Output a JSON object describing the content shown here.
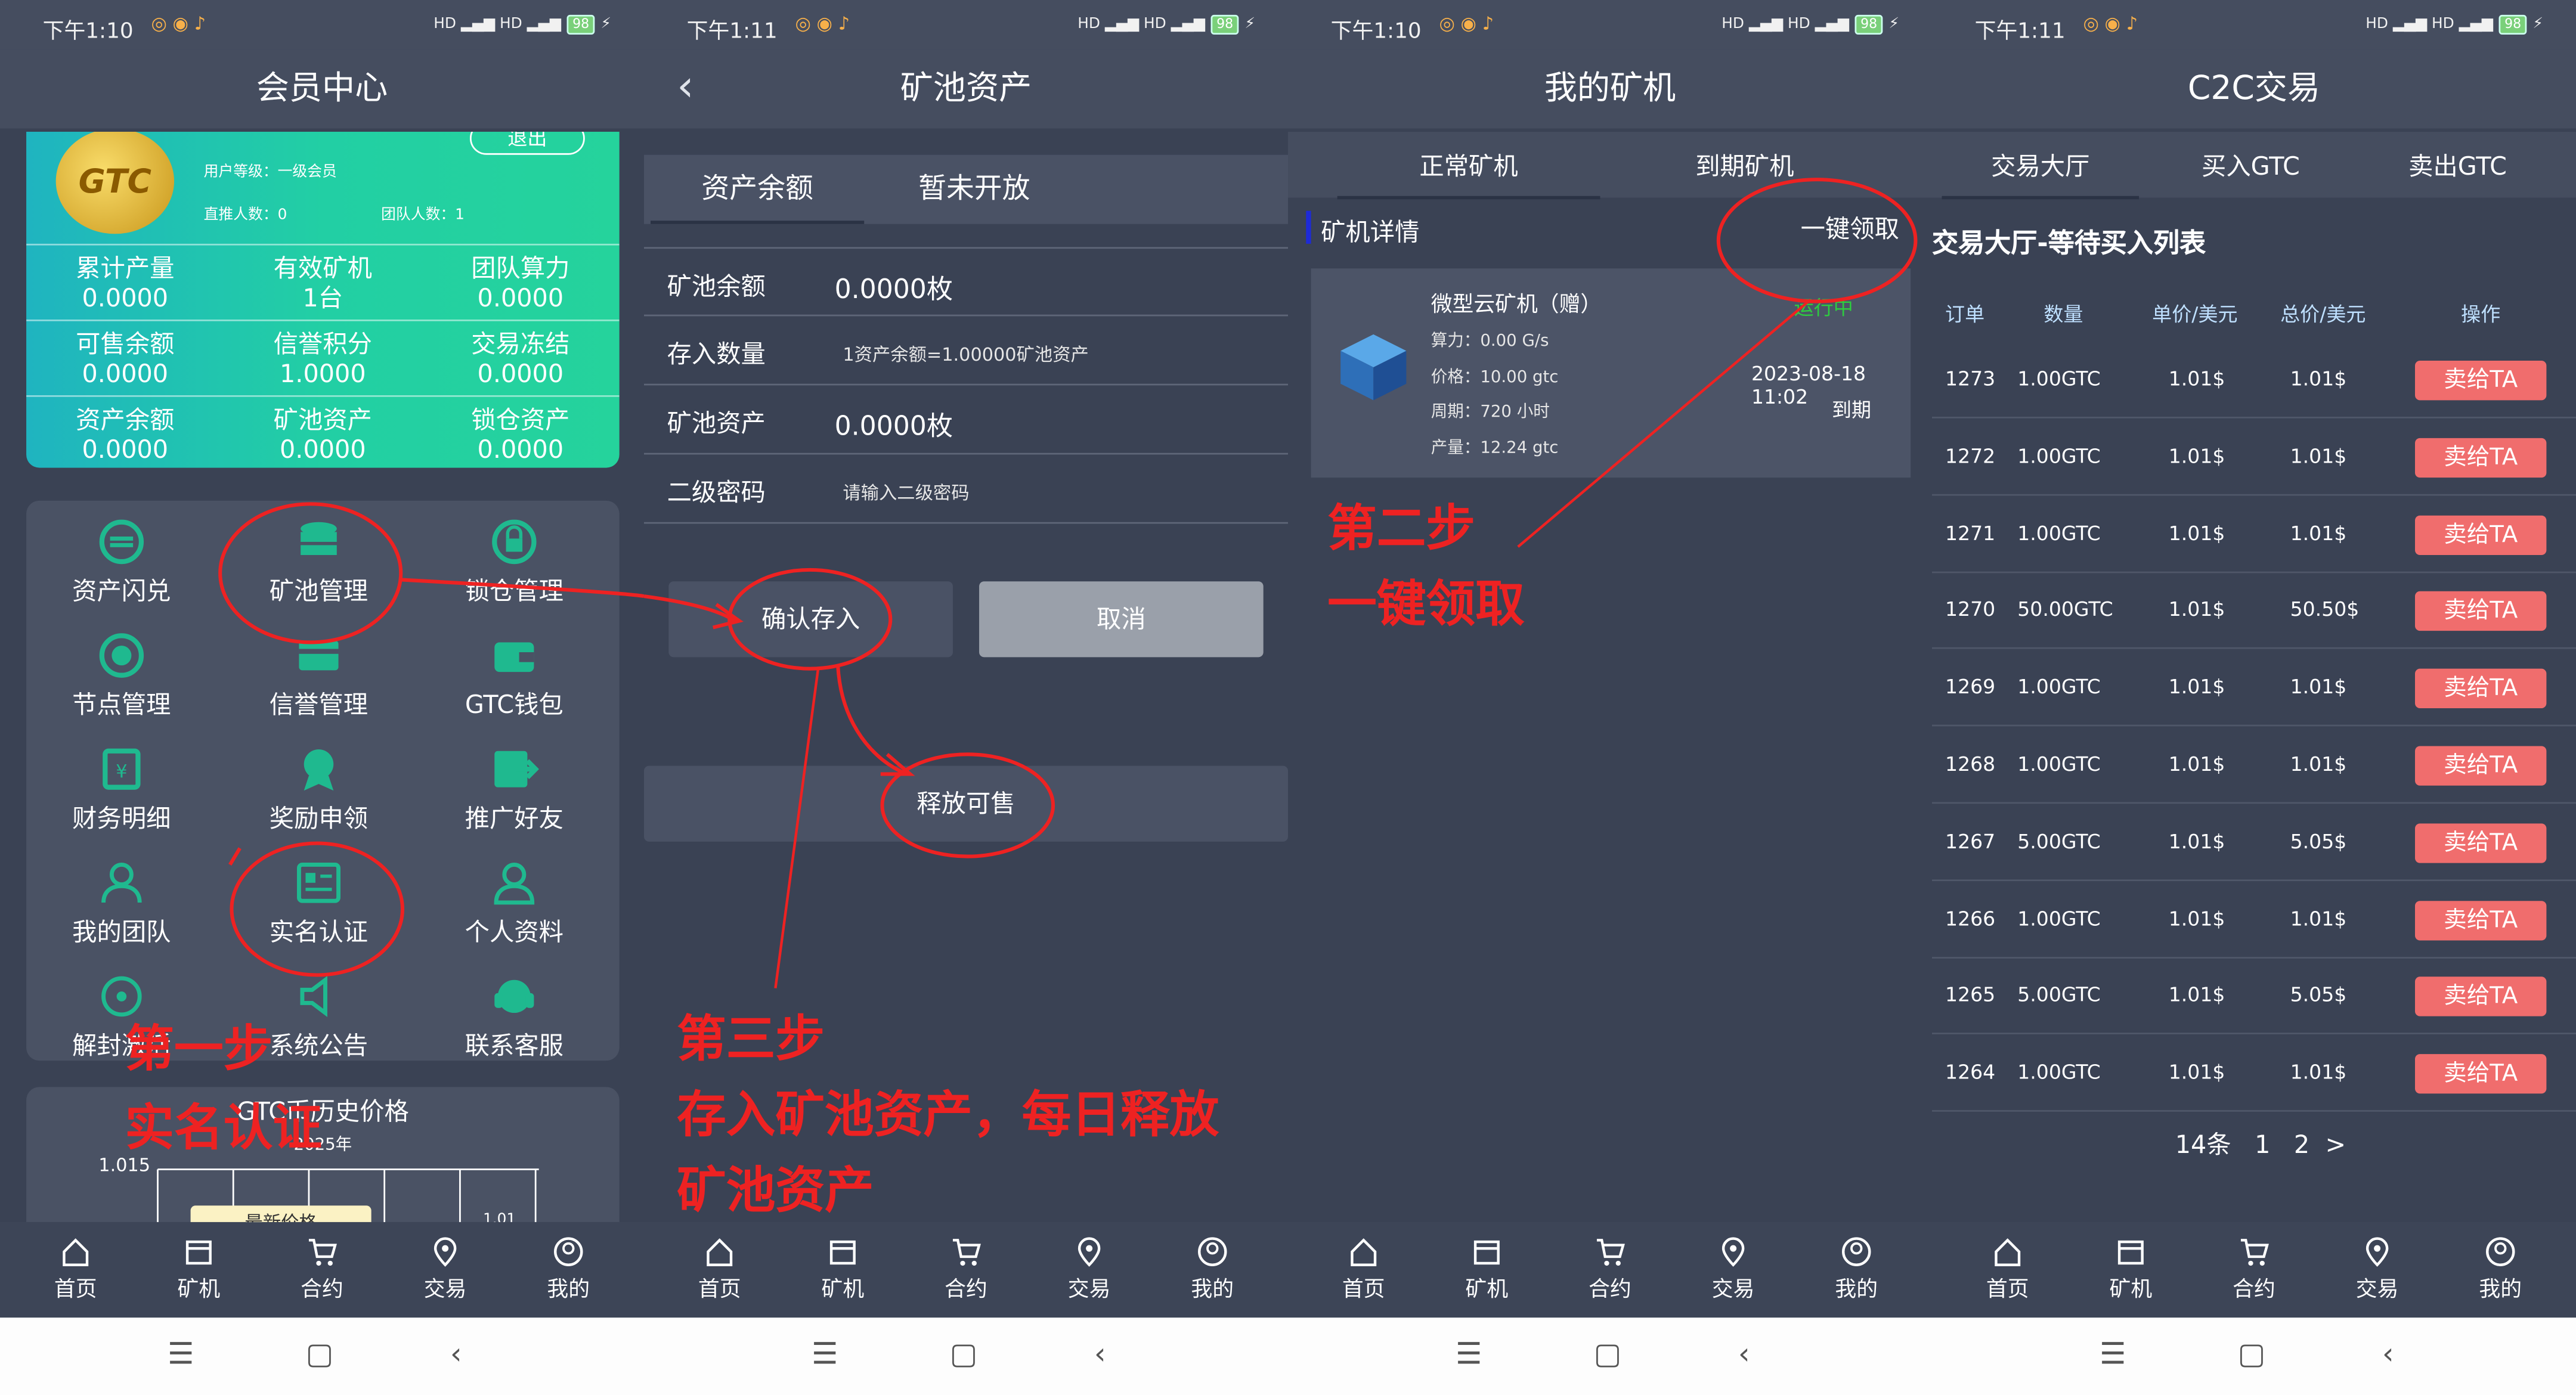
{
  "screens": [
    {
      "status_time": "下午1:10",
      "battery": "98",
      "title": "会员中心",
      "card": {
        "coin_text": "GTC",
        "logout_label": "退出",
        "user_level": "用户等级：一级会员",
        "direct_count": "直推人数：0",
        "team_count": "团队人数：1",
        "stats": [
          {
            "label": "累计产量",
            "value": "0.0000"
          },
          {
            "label": "有效矿机",
            "value": "1台"
          },
          {
            "label": "团队算力",
            "value": "0.0000"
          },
          {
            "label": "可售余额",
            "value": "0.0000"
          },
          {
            "label": "信誉积分",
            "value": "1.0000"
          },
          {
            "label": "交易冻结",
            "value": "0.0000"
          },
          {
            "label": "资产余额",
            "value": "0.0000"
          },
          {
            "label": "矿池资产",
            "value": "0.0000"
          },
          {
            "label": "锁仓资产",
            "value": "0.0000"
          }
        ]
      },
      "menu": [
        "资产闪兑",
        "矿池管理",
        "锁仓管理",
        "节点管理",
        "信誉管理",
        "GTC钱包",
        "财务明细",
        "奖励申领",
        "推广好友",
        "我的团队",
        "实名认证",
        "个人资料",
        "解封激活",
        "系统公告",
        "联系客服"
      ],
      "price_chart": {
        "title": "GTC币历史价格",
        "year": "2025年",
        "y_tick": "1.015",
        "tooltip": "最新价格",
        "last_value": "1.01"
      },
      "annotation": {
        "line1": "第一步",
        "line2": "实名认证"
      }
    },
    {
      "status_time": "下午1:11",
      "battery": "98",
      "title": "矿池资产",
      "tabs": [
        "资产余额",
        "暂未开放"
      ],
      "rows": [
        {
          "label": "矿池余额",
          "value": "0.0000枚"
        },
        {
          "label": "存入数量",
          "hint": "1资产余额=1.00000矿池资产"
        },
        {
          "label": "矿池资产",
          "value": "0.0000枚"
        },
        {
          "label": "二级密码",
          "hint": "请输入二级密码"
        }
      ],
      "confirm_label": "确认存入",
      "cancel_label": "取消",
      "release_label": "释放可售",
      "annotation": {
        "line1": "第三步",
        "line2": "存入矿池资产，每日释放",
        "line3": "矿池资产"
      }
    },
    {
      "status_time": "下午1:10",
      "battery": "98",
      "title": "我的矿机",
      "tabs": [
        "正常矿机",
        "到期矿机"
      ],
      "detail_title": "矿机详情",
      "claim_all": "一键领取",
      "machine": {
        "name": "微型云矿机（赠）",
        "status": "运行中",
        "power": "算力：0.00 G/s",
        "price": "价格：10.00 gtc",
        "cycle": "周期：720 小时",
        "output": "产量：12.24 gtc",
        "expire_date": "2023-08-18 11:02",
        "expire_label": "到期"
      },
      "annotation": {
        "line1": "第二步",
        "line2": "一键领取"
      }
    },
    {
      "status_time": "下午1:11",
      "battery": "98",
      "title": "C2C交易",
      "tabs": [
        "交易大厅",
        "买入GTC",
        "卖出GTC"
      ],
      "section_title": "交易大厅-等待买入列表",
      "columns": [
        "订单",
        "数量",
        "单价/美元",
        "总价/美元",
        "操作"
      ],
      "sell_label": "卖给TA",
      "rows": [
        [
          "1273",
          "1.00GTC",
          "1.01$",
          "1.01$"
        ],
        [
          "1272",
          "1.00GTC",
          "1.01$",
          "1.01$"
        ],
        [
          "1271",
          "1.00GTC",
          "1.01$",
          "1.01$"
        ],
        [
          "1270",
          "50.00GTC",
          "1.01$",
          "50.50$"
        ],
        [
          "1269",
          "1.00GTC",
          "1.01$",
          "1.01$"
        ],
        [
          "1268",
          "1.00GTC",
          "1.01$",
          "1.01$"
        ],
        [
          "1267",
          "5.00GTC",
          "1.01$",
          "5.05$"
        ],
        [
          "1266",
          "1.00GTC",
          "1.01$",
          "1.01$"
        ],
        [
          "1265",
          "5.00GTC",
          "1.01$",
          "5.05$"
        ],
        [
          "1264",
          "1.00GTC",
          "1.01$",
          "1.01$"
        ]
      ],
      "pagination": {
        "total": "14条",
        "pages": [
          "1",
          "2"
        ],
        "next": ">"
      }
    }
  ],
  "tabbar": [
    "首页",
    "矿机",
    "合约",
    "交易",
    "我的"
  ],
  "icons": [
    "home-icon",
    "miner-icon",
    "cart-icon",
    "location-icon",
    "user-icon",
    "menu-icon",
    "square-icon",
    "back-icon"
  ],
  "colors": {
    "page_bg": "#3a4254",
    "header_bg": "#454d5f",
    "accent_green": "#22cfa4",
    "sell_red": "#f06d6d",
    "annotation_red": "#ee2222",
    "running_green": "#2ecc40"
  }
}
